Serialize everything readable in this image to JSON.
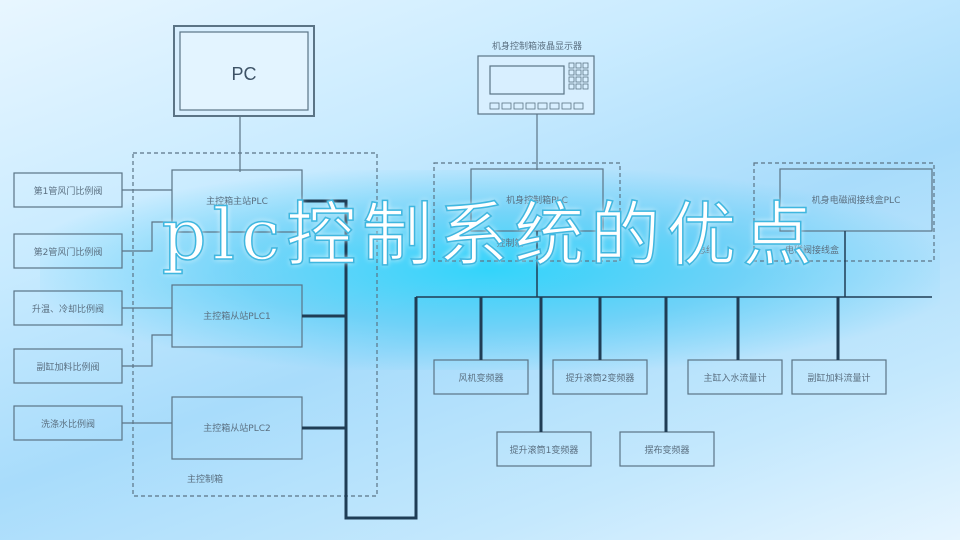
{
  "title": "plc控制系统的优点",
  "diagram": {
    "pc": "PC",
    "hmi_label": "机身控制箱液晶显示器",
    "left_valves": [
      "第1管风门比例阀",
      "第2管风门比例阀",
      "升温、冷却比例阀",
      "副缸加料比例阀",
      "洗涤水比例阀"
    ],
    "main_cabinet": {
      "label": "主控制箱",
      "plcs": [
        "主控箱主站PLC",
        "主控箱从站PLC1",
        "主控箱从站PLC2"
      ]
    },
    "body_cabinet": {
      "label": "控制箱",
      "plc": "机身控制箱PLC"
    },
    "wiring_box": {
      "label": "电磁阀接线盒",
      "plc": "机身电磁阀接线盒PLC"
    },
    "bus_label": "总线",
    "devices_row1": [
      "风机变频器",
      "提升滚筒2变频器",
      "主缸入水流量计",
      "副缸加料流量计"
    ],
    "devices_row2": [
      "提升滚筒1变频器",
      "摆布变频器"
    ]
  }
}
